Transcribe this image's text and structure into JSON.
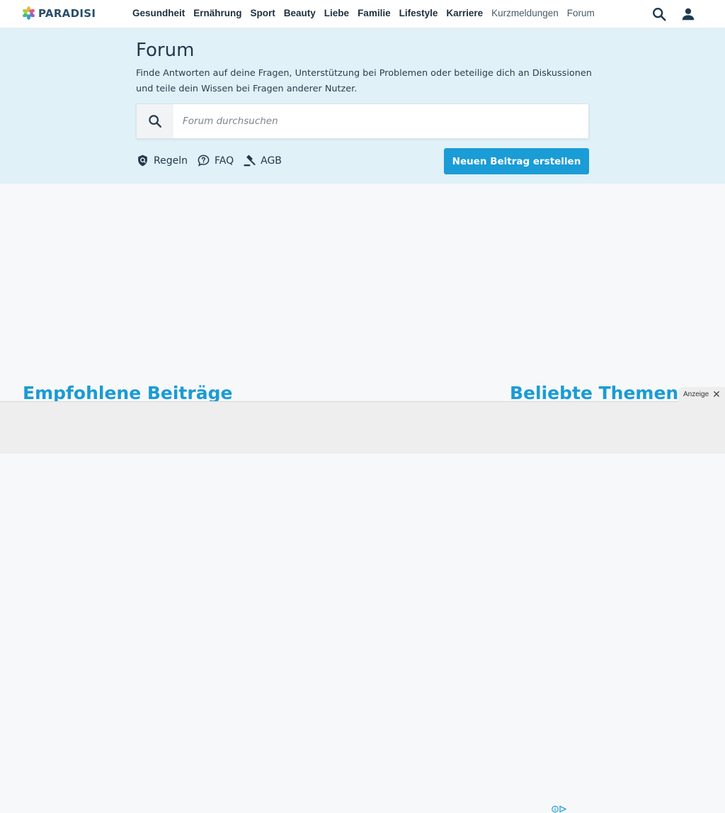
{
  "header": {
    "logo_text": "PARADISI",
    "nav": [
      {
        "label": "Gesundheit",
        "style": "bold"
      },
      {
        "label": "Ernährung",
        "style": "bold"
      },
      {
        "label": "Sport",
        "style": "bold"
      },
      {
        "label": "Beauty",
        "style": "bold"
      },
      {
        "label": "Liebe",
        "style": "bold"
      },
      {
        "label": "Familie",
        "style": "bold"
      },
      {
        "label": "Lifestyle",
        "style": "bold"
      },
      {
        "label": "Karriere",
        "style": "bold"
      },
      {
        "label": "Kurzmeldungen",
        "style": "light"
      },
      {
        "label": "Forum",
        "style": "light"
      }
    ],
    "icons": {
      "search": "search-icon",
      "user": "user-icon"
    }
  },
  "hero": {
    "title": "Forum",
    "description": "Finde Antworten auf deine Fragen, Unterstützung bei Problemen oder beteilige dich an Diskussionen und teile dein Wissen bei Fragen anderer Nutzer.",
    "search": {
      "placeholder": "Forum durchsuchen",
      "value": ""
    },
    "links": [
      {
        "label": "Regeln",
        "icon": "shield-icon"
      },
      {
        "label": "FAQ",
        "icon": "question-bubble-icon"
      },
      {
        "label": "AGB",
        "icon": "gavel-icon"
      }
    ],
    "cta_label": "Neuen Beitrag erstellen"
  },
  "sections": {
    "recommended_title": "Empfohlene Beiträge",
    "popular_title": "Beliebte Themen"
  },
  "ad": {
    "label": "Anzeige",
    "close_symbol": "✕"
  },
  "colors": {
    "accent": "#1a9cd6",
    "hero_bg": "#e0f1f8",
    "heading": "#23394b",
    "section_title": "#1b9bd4"
  }
}
